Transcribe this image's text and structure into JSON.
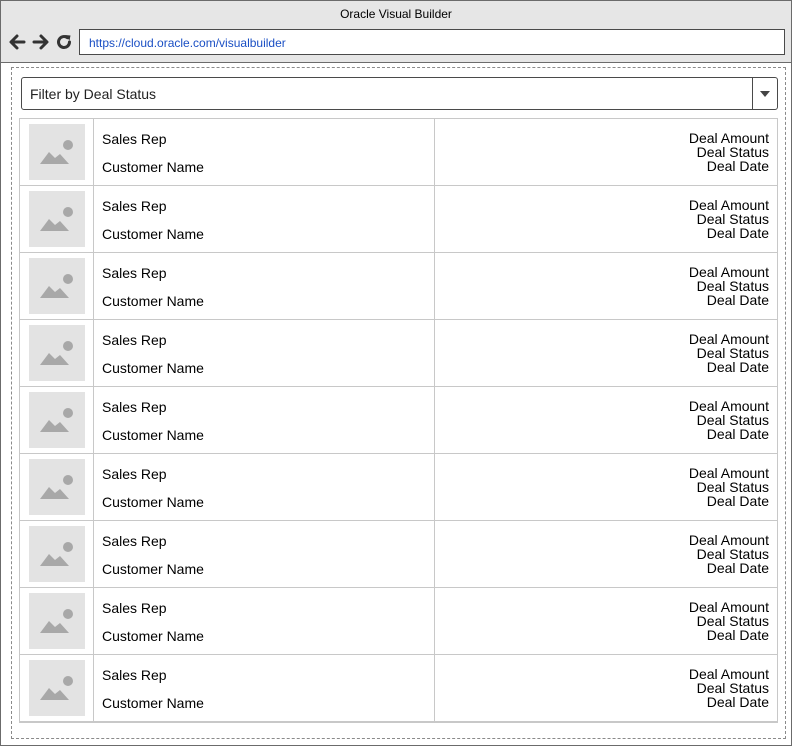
{
  "window": {
    "title": "Oracle Visual Builder"
  },
  "browser": {
    "url": "https://cloud.oracle.com/visualbuilder"
  },
  "filter": {
    "label": "Filter by Deal Status"
  },
  "rows": [
    {
      "sales_rep": "Sales Rep",
      "customer": "Customer Name",
      "amount": "Deal Amount",
      "status": "Deal Status",
      "date": "Deal Date"
    },
    {
      "sales_rep": "Sales Rep",
      "customer": "Customer Name",
      "amount": "Deal Amount",
      "status": "Deal Status",
      "date": "Deal Date"
    },
    {
      "sales_rep": "Sales Rep",
      "customer": "Customer Name",
      "amount": "Deal Amount",
      "status": "Deal Status",
      "date": "Deal Date"
    },
    {
      "sales_rep": "Sales Rep",
      "customer": "Customer Name",
      "amount": "Deal Amount",
      "status": "Deal Status",
      "date": "Deal Date"
    },
    {
      "sales_rep": "Sales Rep",
      "customer": "Customer Name",
      "amount": "Deal Amount",
      "status": "Deal Status",
      "date": "Deal Date"
    },
    {
      "sales_rep": "Sales Rep",
      "customer": "Customer Name",
      "amount": "Deal Amount",
      "status": "Deal Status",
      "date": "Deal Date"
    },
    {
      "sales_rep": "Sales Rep",
      "customer": "Customer Name",
      "amount": "Deal Amount",
      "status": "Deal Status",
      "date": "Deal Date"
    },
    {
      "sales_rep": "Sales Rep",
      "customer": "Customer Name",
      "amount": "Deal Amount",
      "status": "Deal Status",
      "date": "Deal Date"
    },
    {
      "sales_rep": "Sales Rep",
      "customer": "Customer Name",
      "amount": "Deal Amount",
      "status": "Deal Status",
      "date": "Deal Date"
    }
  ],
  "icons": {
    "back": "arrow-left-icon",
    "forward": "arrow-right-icon",
    "reload": "reload-icon",
    "dropdown": "chevron-down-icon",
    "thumbnail": "image-placeholder-icon"
  },
  "colors": {
    "titlebar": "#e6e6e6",
    "url_text": "#1a4fc4",
    "placeholder": "#e3e3e3",
    "placeholder_glyph": "#a8a8a8"
  }
}
